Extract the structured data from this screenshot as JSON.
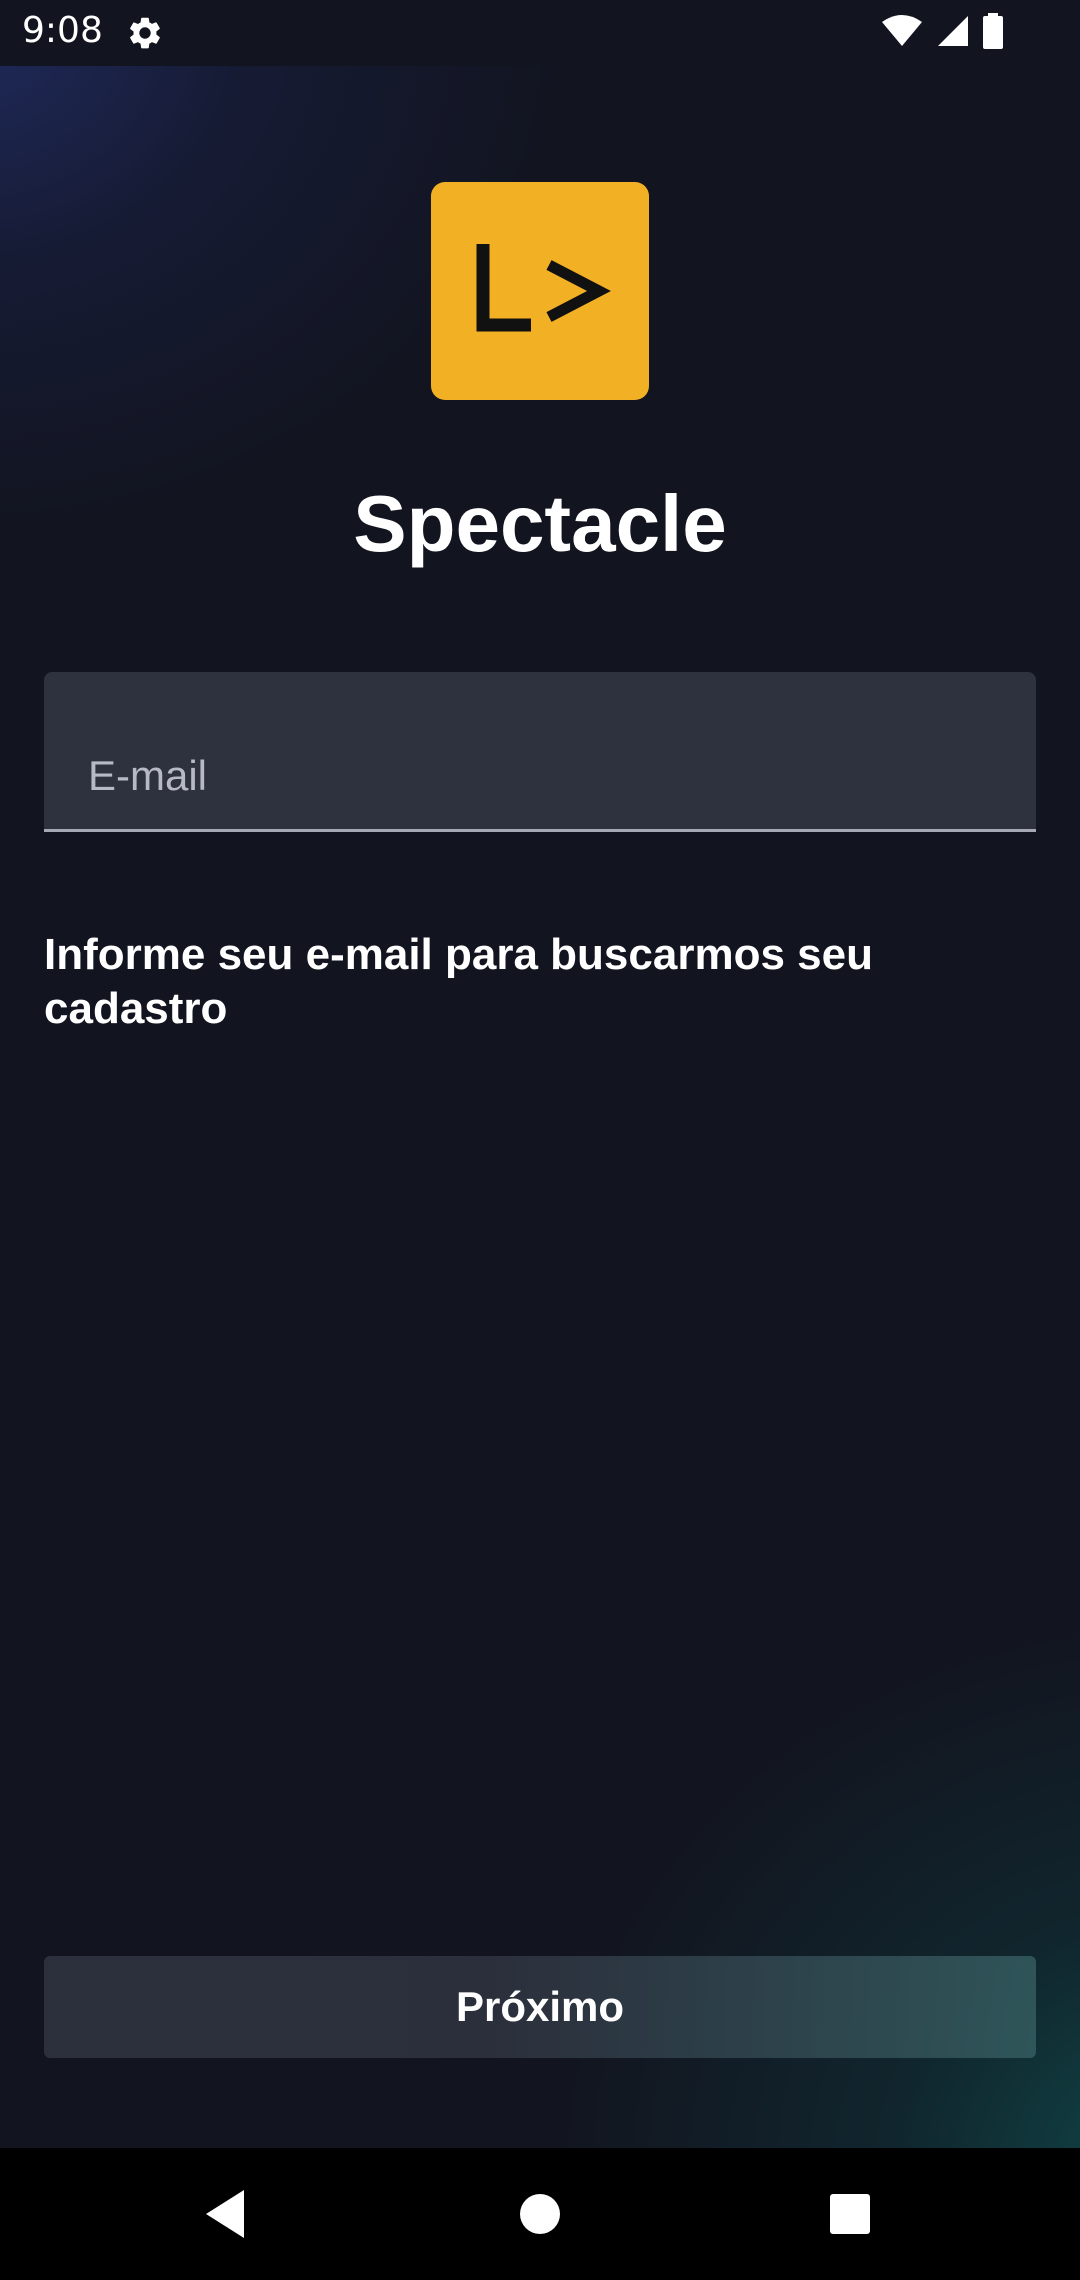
{
  "status_bar": {
    "time": "9:08",
    "icons": [
      "settings-gear-icon",
      "wifi-icon",
      "cell-signal-icon",
      "battery-icon"
    ]
  },
  "app": {
    "logo_icon": "code-prompt-logo",
    "logo_color": "#f2b025",
    "title": "Spectacle"
  },
  "login_form": {
    "email_placeholder": "E-mail",
    "email_value": "",
    "helper_text": "Informe seu e-mail para buscarmos seu cadastro",
    "next_button_label": "Próximo"
  },
  "navigation_bar": {
    "buttons": [
      "back-icon",
      "home-icon",
      "recents-icon"
    ]
  },
  "colors": {
    "background": "#12141f",
    "input_background": "#2e323f",
    "accent": "#f2b025",
    "text": "#ffffff"
  }
}
